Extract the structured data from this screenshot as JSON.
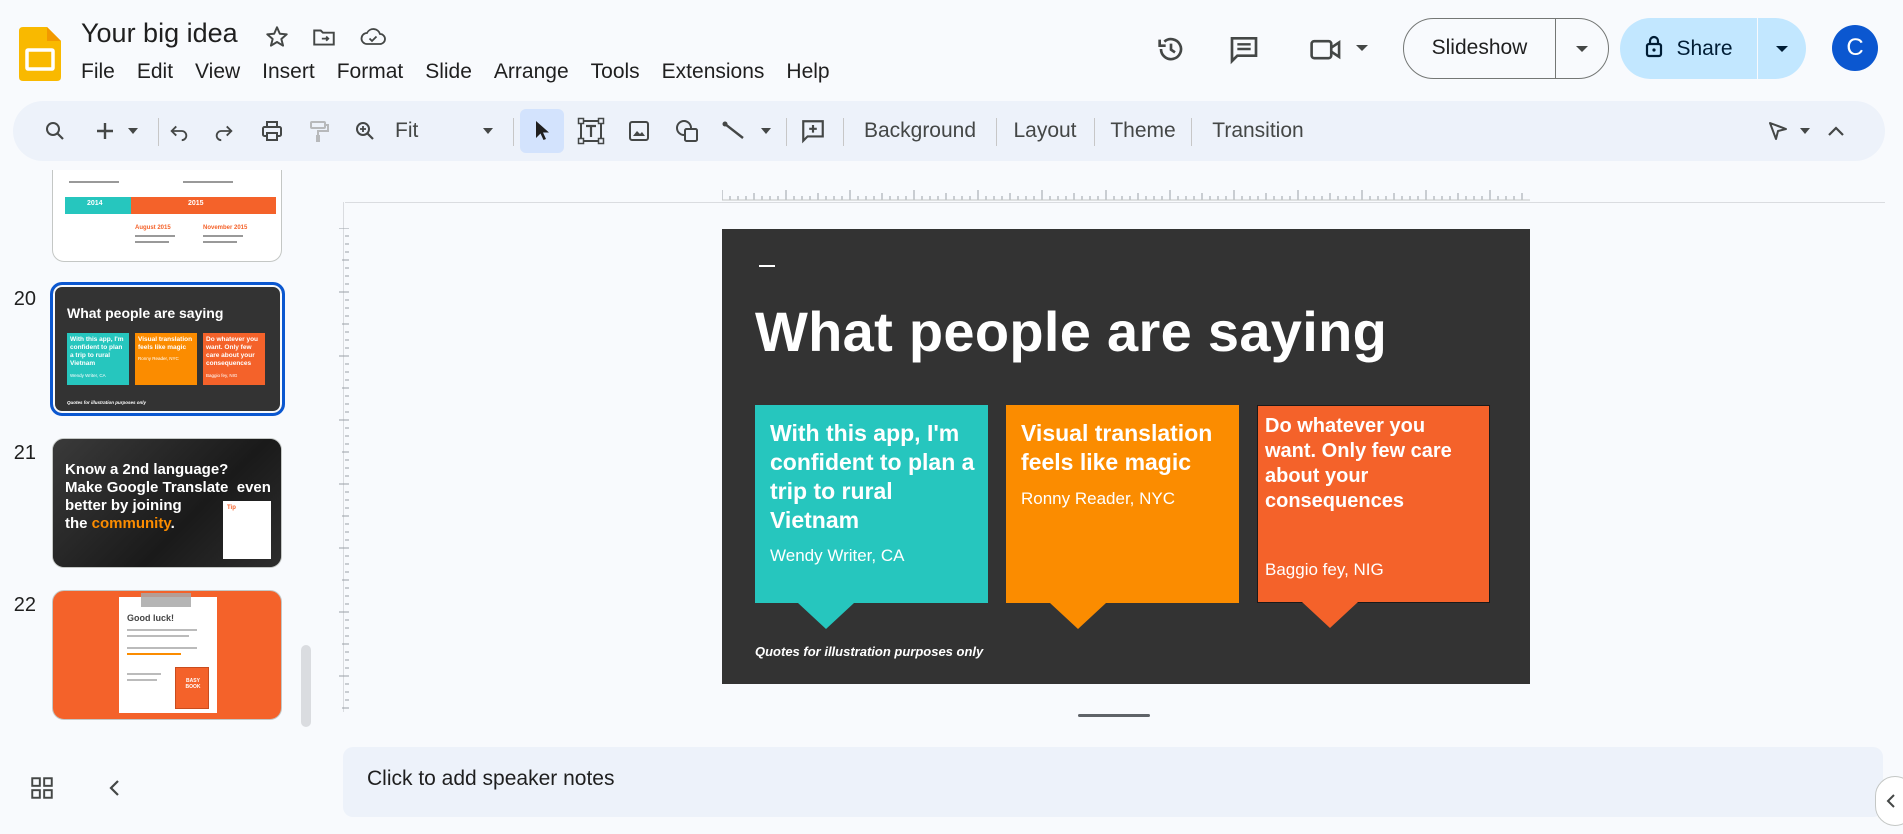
{
  "app": {
    "doc_title": "Your big idea",
    "menu": [
      "File",
      "Edit",
      "View",
      "Insert",
      "Format",
      "Slide",
      "Arrange",
      "Tools",
      "Extensions",
      "Help"
    ],
    "slideshow_label": "Slideshow",
    "share_label": "Share",
    "avatar_letter": "C",
    "accent": "#0b57d0",
    "share_bg": "#c2e7ff"
  },
  "toolbar": {
    "zoom": "Fit",
    "background": "Background",
    "layout": "Layout",
    "theme": "Theme",
    "transition": "Transition"
  },
  "filmstrip": {
    "slides": [
      {
        "num": "20",
        "title": "What people are saying",
        "cards": [
          "With this app, I'm confident to plan a trip to rural Vietnam",
          "Visual translation feels like magic",
          "Do whatever you want. Only few care about your consequences"
        ],
        "authors": [
          "Wendy Writer, CA",
          "Ronny Reader, NYC",
          "Baggio fey, NIG"
        ],
        "footnote": "Quotes for illustration purposes only"
      },
      {
        "num": "21",
        "line1": "Know a 2nd language?",
        "line2": "Make Google Translate  even",
        "line3": "better by joining",
        "line4a": "the ",
        "line4b": "community",
        "line4c": ".",
        "tip": "Tip"
      },
      {
        "num": "22",
        "title": "Good luck!",
        "book": "BASY BOOK"
      }
    ],
    "prev_slide": {
      "year1": "2014",
      "year2": "2015",
      "event1": "August 2015",
      "event2": "November 2015"
    }
  },
  "slide": {
    "title": "What people are saying",
    "footnote": "Quotes for illustration purposes only",
    "cards": [
      {
        "quote": "With this app, I'm confident to plan a trip to rural Vietnam",
        "author": "Wendy Writer, CA",
        "color": "#26c6be"
      },
      {
        "quote": "Visual translation feels like magic",
        "author": "Ronny Reader, NYC",
        "color": "#fb8c00"
      },
      {
        "quote": "Do whatever you want. Only few care about your consequences",
        "author": "Baggio fey, NIG",
        "color": "#f4622a"
      }
    ]
  },
  "notes": {
    "placeholder": "Click to add speaker notes"
  }
}
